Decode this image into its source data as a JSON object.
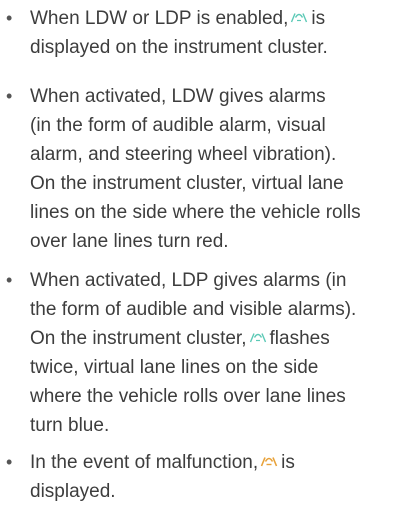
{
  "colors": {
    "text": "#3d3d3d",
    "lane_icon_normal": "#5cc9b6",
    "lane_icon_malfunction": "#e8a23a"
  },
  "icons": {
    "lane_icon_normal": "lane-departure-icon-green",
    "lane_icon_malfunction": "lane-departure-icon-amber"
  },
  "items": [
    {
      "bullet": "•",
      "lines": [
        {
          "a": "When LDW or LDP is enabled,",
          "b": "is"
        },
        {
          "text": "displayed on the instrument cluster."
        }
      ]
    },
    {
      "bullet": "•",
      "lines": [
        "When activated, LDW gives alarms",
        "(in the form of audible alarm, visual",
        "alarm, and steering wheel vibration).",
        "On the instrument cluster, virtual lane",
        "lines on the side where the vehicle rolls",
        "over lane lines turn red."
      ]
    },
    {
      "bullet": "•",
      "lines": [
        {
          "text": "When activated, LDP gives alarms (in"
        },
        {
          "text": "the form of audible and visible alarms)."
        },
        {
          "a": "On the instrument cluster,",
          "b": "flashes"
        },
        {
          "text": "twice, virtual lane lines on the side"
        },
        {
          "text": "where the vehicle rolls over lane lines"
        },
        {
          "text": "turn blue."
        }
      ]
    },
    {
      "bullet": "•",
      "lines": [
        {
          "a": "In the event of malfunction,",
          "b": "is"
        },
        {
          "text": "displayed."
        }
      ]
    }
  ]
}
